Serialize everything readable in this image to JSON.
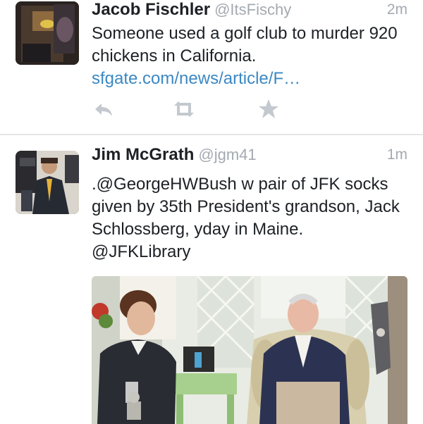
{
  "tweets": [
    {
      "name": "Jacob Fischler",
      "handle": "@ItsFischy",
      "time": "2m",
      "text": "Someone used a golf club to murder 920 chickens in California.",
      "link": "sfgate.com/news/article/F…",
      "avatar_icon": "avatar-photo",
      "actions": [
        "reply-icon",
        "retweet-icon",
        "favorite-icon"
      ]
    },
    {
      "name": "Jim McGrath",
      "handle": "@jgm41",
      "time": "1m",
      "text": ".@GeorgeHWBush w pair of JFK socks given by 35th President's grandson, Jack Schlossberg, yday in Maine. @JFKLibrary",
      "avatar_icon": "avatar-photo",
      "media": "photo"
    }
  ],
  "colors": {
    "link": "#3b88c3",
    "muted": "#a3aab1",
    "icon": "#c3c9ce",
    "divider": "#e6e6e6"
  }
}
